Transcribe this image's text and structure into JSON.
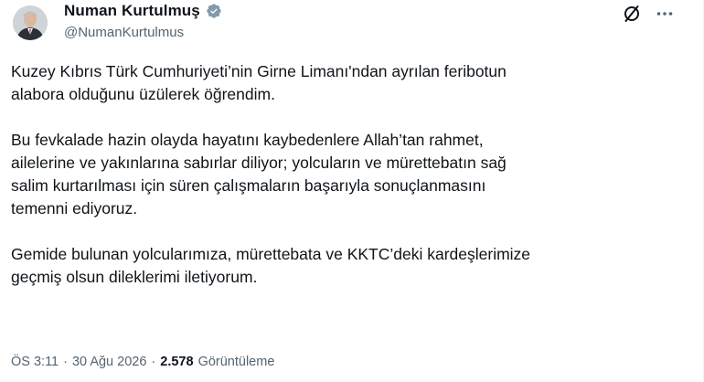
{
  "post": {
    "author": {
      "display_name": "Numan Kurtulmuş",
      "handle": "@NumanKurtulmus",
      "verified_icon": "verified-badge-icon",
      "verified_color": "#829aab"
    },
    "actions": {
      "grok_icon": "grok-slash-icon",
      "more_icon": "more-dots-icon"
    },
    "paragraphs": [
      "Kuzey Kıbrıs Türk Cumhuriyeti’nin Girne Limanı'ndan ayrılan feribotun\nalabora olduğunu üzülerek öğrendim.",
      "Bu fevkalade hazin olayda hayatını kaybedenlere Allah’tan rahmet,\nailelerine ve yakınlarına sabırlar diliyor; yolcuların ve mürettebatın sağ\nsalim kurtarılması için süren çalışmaların başarıyla sonuçlanmasını\ntemenni ediyoruz.",
      "Gemide bulunan yolcularımıza, mürettebata ve KKTC’deki kardeşlerimize\ngeçmiş olsun dileklerimi iletiyorum."
    ],
    "meta": {
      "time": "ÖS 3:11",
      "separator1": "·",
      "date": "30 Ağu 2026",
      "separator2": "·",
      "views_count": "2.578",
      "views_label": "Görüntüleme"
    }
  }
}
